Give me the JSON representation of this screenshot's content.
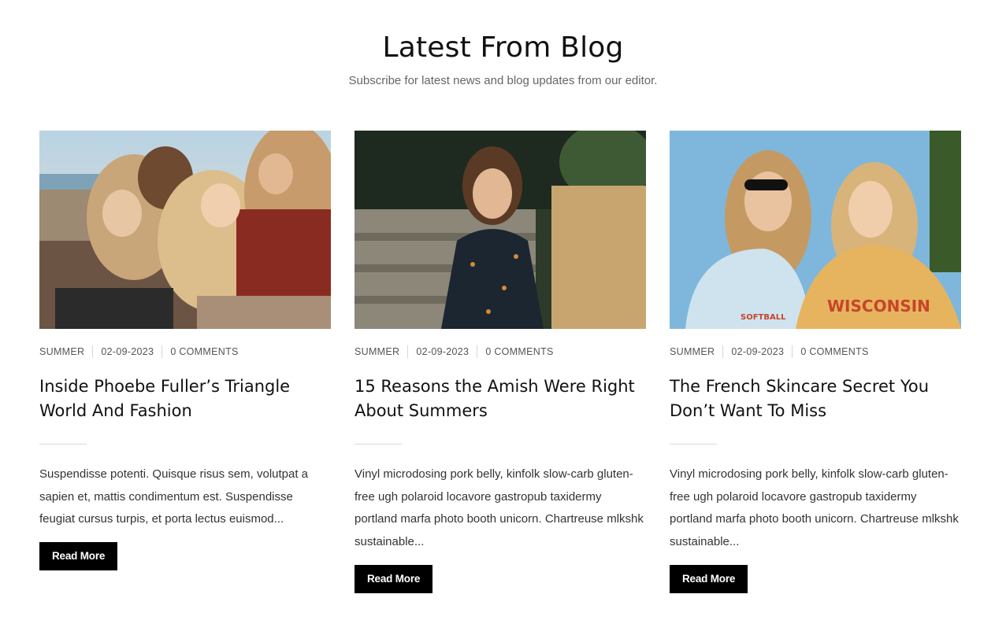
{
  "header": {
    "title": "Latest From Blog",
    "subtitle": "Subscribe for latest news and blog updates from our editor."
  },
  "posts": [
    {
      "category": "SUMMER",
      "date": "02-09-2023",
      "comments": "0 COMMENTS",
      "title_line1": "Inside Phoebe Fuller’s Triangle",
      "title_line2": "World And Fashion",
      "excerpt": "Suspendisse potenti. Quisque risus sem, volutpat a sapien et, mattis condimentum est. Suspendisse feugiat cursus turpis, et porta lectus euismod...",
      "button": "Read More",
      "image_desc_icon": "photo-group-beach"
    },
    {
      "category": "SUMMER",
      "date": "02-09-2023",
      "comments": "0 COMMENTS",
      "title_line1": "15 Reasons the Amish Were Right",
      "title_line2": "About Summers",
      "excerpt": "Vinyl microdosing pork belly, kinfolk slow-carb gluten-free ugh polaroid locavore gastropub taxidermy portland marfa photo booth unicorn. Chartreuse mlkshk sustainable...",
      "button": "Read More",
      "image_desc_icon": "photo-woman-steps"
    },
    {
      "category": "SUMMER",
      "date": "02-09-2023",
      "comments": "0 COMMENTS",
      "title_line1": "The French Skincare Secret You",
      "title_line2": "Don’t Want To Miss",
      "excerpt": "Vinyl microdosing pork belly, kinfolk slow-carb gluten-free ugh polaroid locavore gastropub taxidermy portland marfa photo booth unicorn. Chartreuse mlkshk sustainable...",
      "button": "Read More",
      "image_desc_icon": "photo-two-women-sky"
    }
  ],
  "colors": {
    "button_bg": "#000000",
    "button_text": "#ffffff",
    "meta_text": "#555555",
    "divider": "#d9d9d9"
  }
}
